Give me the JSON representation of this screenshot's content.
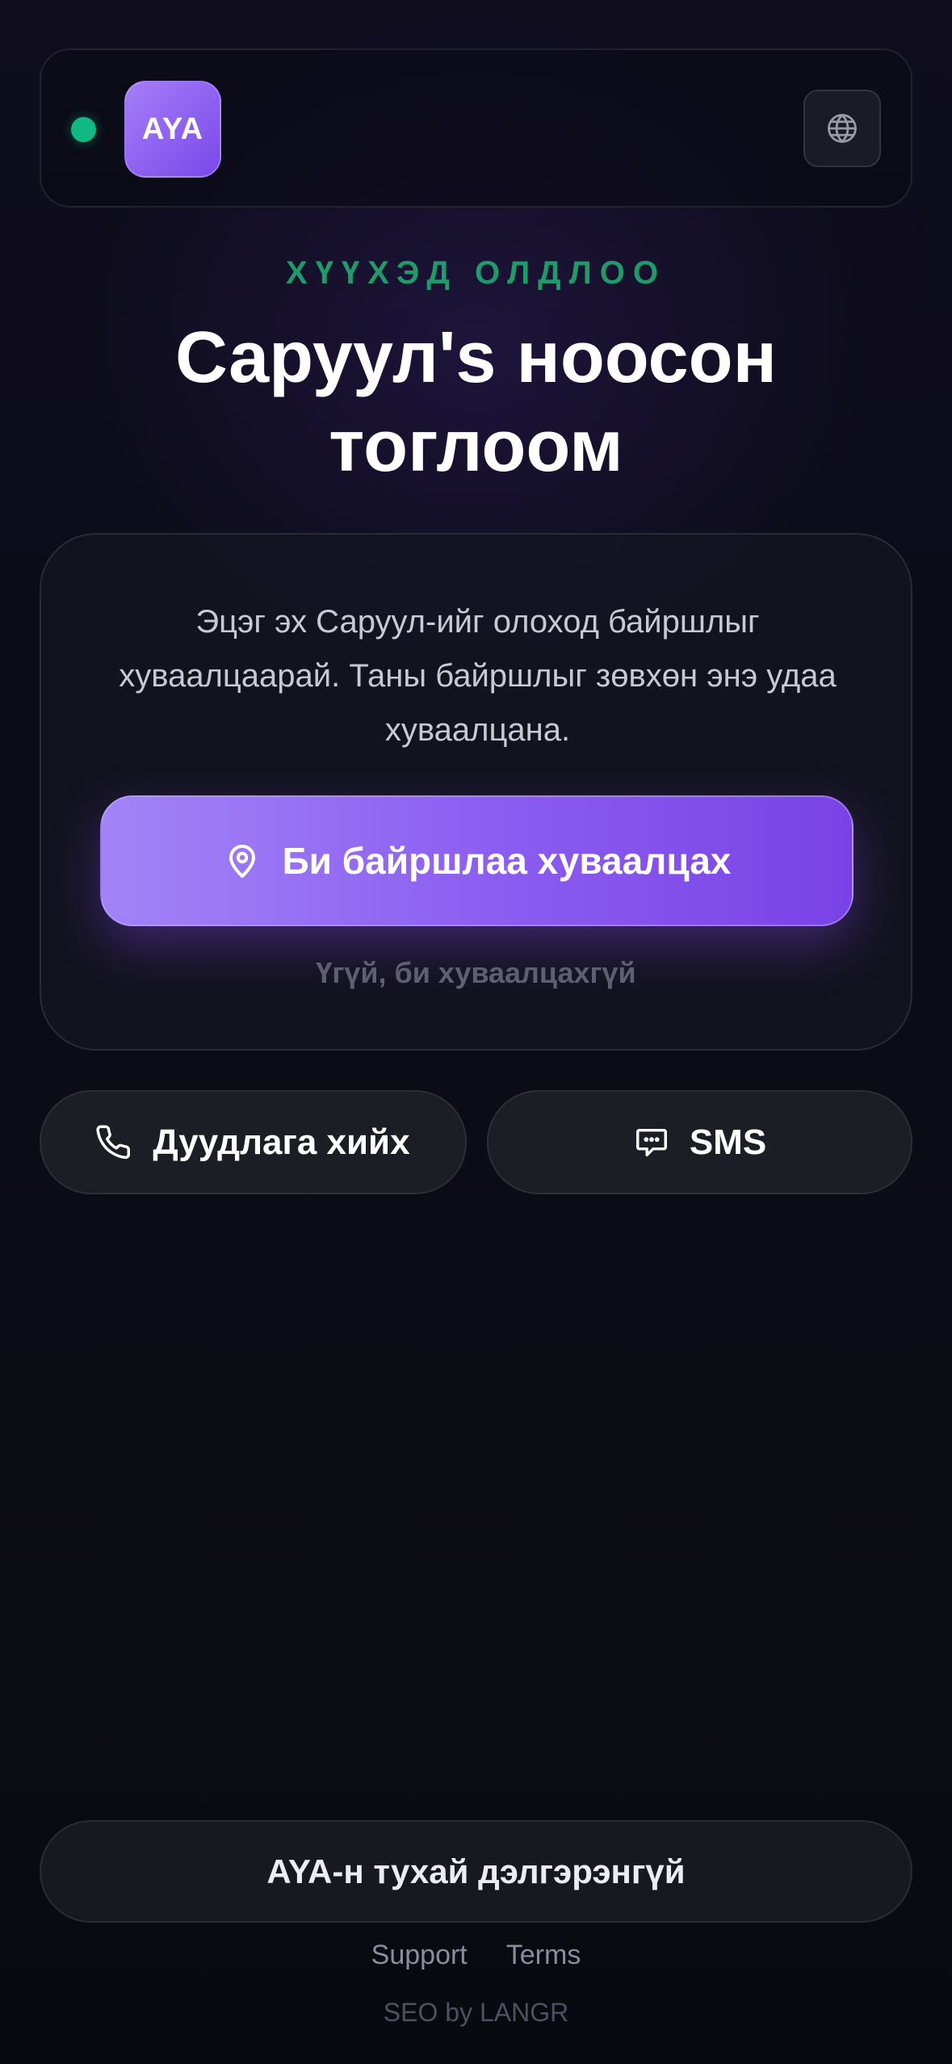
{
  "header": {
    "logo_text": "AYA",
    "status": "online",
    "language_icon": "globe-icon"
  },
  "hero": {
    "eyebrow": "ХҮҮХЭД ОЛДЛОО",
    "title": "Саруул's ноосон тоглоом"
  },
  "card": {
    "message": "Эцэг эх Саруул-ийг олоход байршлыг хуваалцаарай. Таны байршлыг зөвхөн энэ удаа хуваалцана.",
    "share_button": "Би байршлаа хуваалцах",
    "share_icon": "map-pin-icon",
    "decline_link": "Үгүй, би хуваалцахгүй"
  },
  "actions": {
    "call_label": "Дуудлага хийх",
    "call_icon": "phone-icon",
    "sms_label": "SMS",
    "sms_icon": "message-icon"
  },
  "footer": {
    "more_button": "AYA-н тухай дэлгэрэнгүй",
    "links": [
      "Support",
      "Terms"
    ],
    "credit": "SEO by LANGR"
  },
  "colors": {
    "accent": "#8b5cf6",
    "status_green": "#10b981",
    "background": "#0c0c18"
  }
}
